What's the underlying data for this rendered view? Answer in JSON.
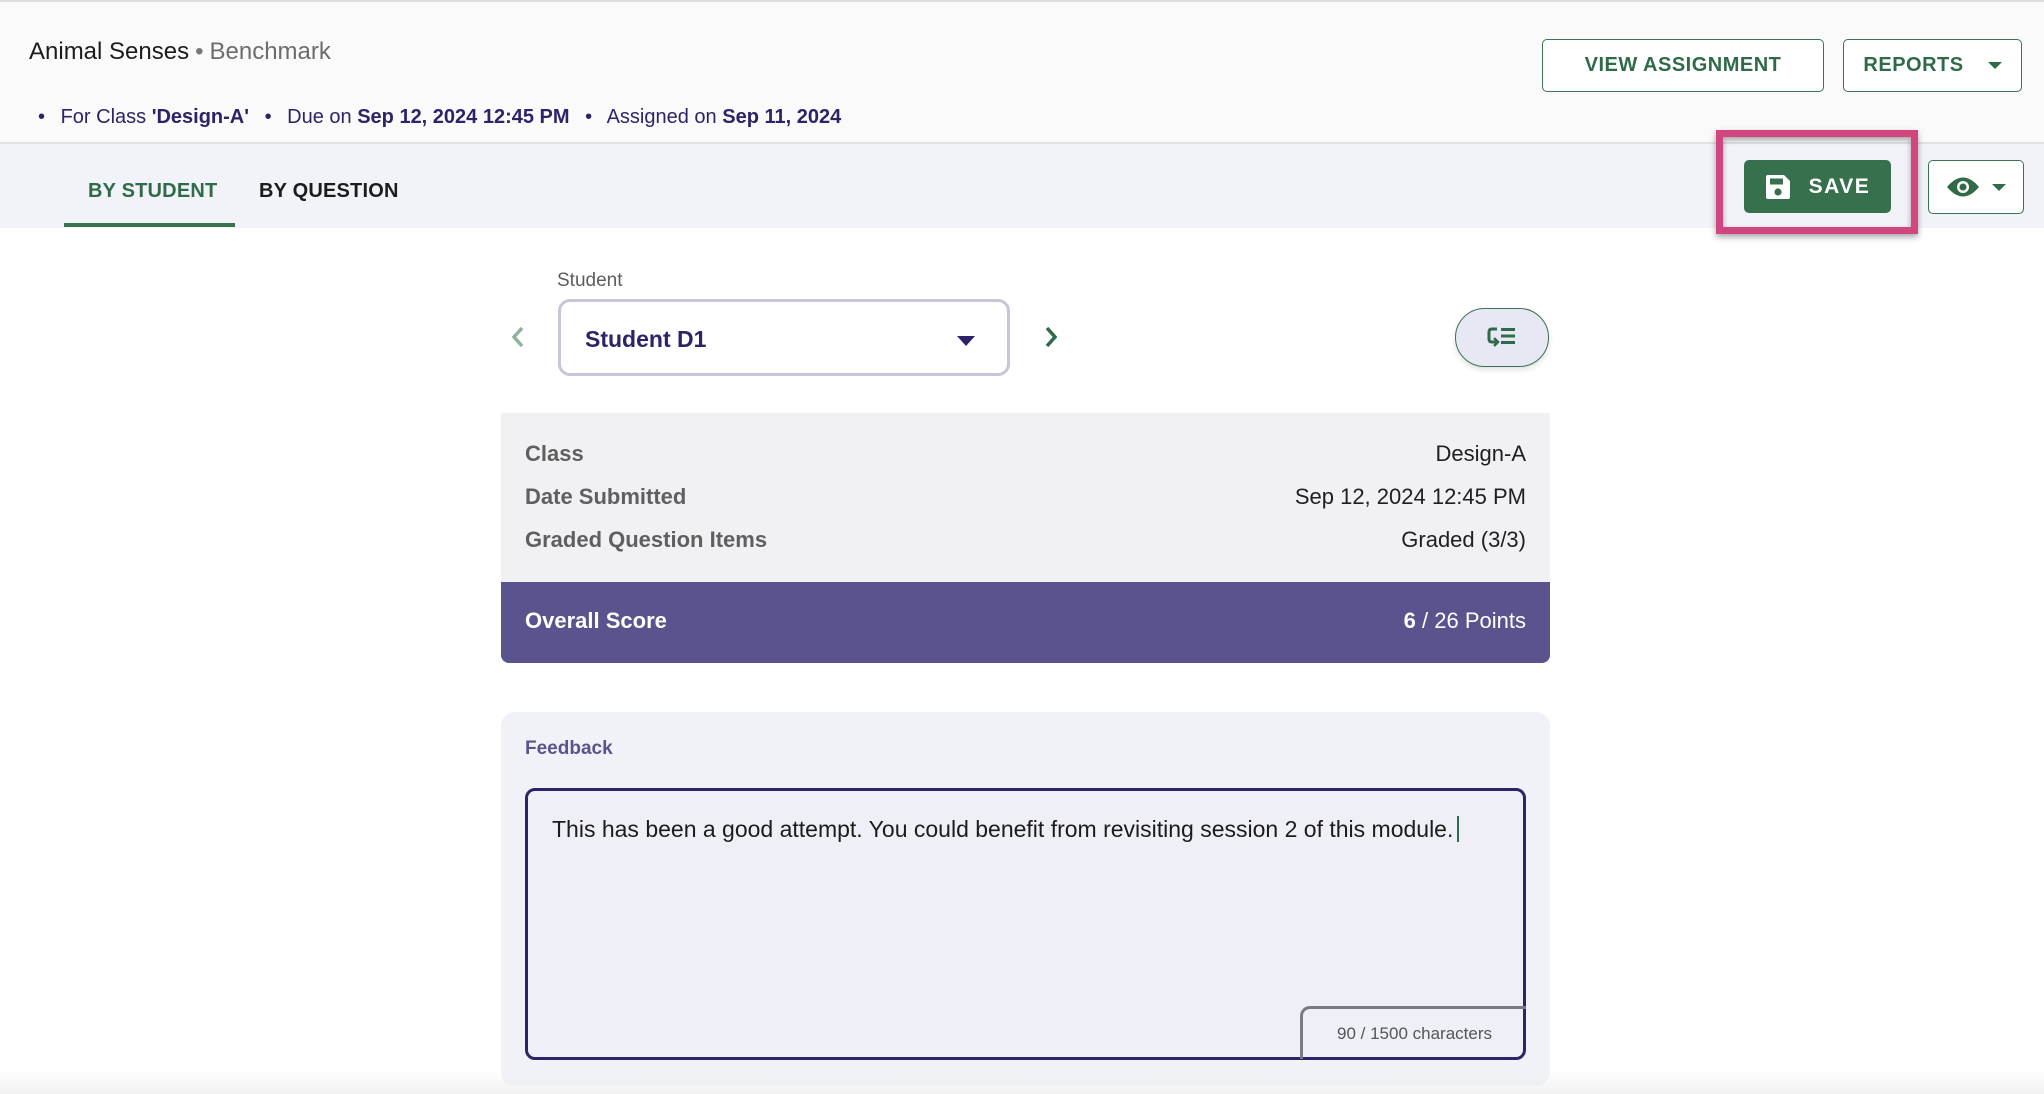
{
  "header": {
    "title": "Animal Senses",
    "separator": "•",
    "subtitle": "Benchmark",
    "meta": {
      "bullet": "•",
      "class_prefix": "For Class ",
      "class_value": "'Design-A'",
      "due_prefix": "Due on ",
      "due_value": "Sep 12, 2024 12:45 PM",
      "assigned_prefix": "Assigned on ",
      "assigned_value": "Sep 11, 2024"
    },
    "view_assignment_label": "VIEW ASSIGNMENT",
    "reports_label": "REPORTS"
  },
  "tabs": [
    {
      "label": "BY STUDENT",
      "active": true
    },
    {
      "label": "BY QUESTION",
      "active": false
    }
  ],
  "toolbar": {
    "save_label": "SAVE",
    "visibility_icon": "eye-icon"
  },
  "student_selector": {
    "label": "Student",
    "selected": "Student D1"
  },
  "info": {
    "rows": [
      {
        "label": "Class",
        "value": "Design-A"
      },
      {
        "label": "Date Submitted",
        "value": "Sep 12, 2024 12:45 PM"
      },
      {
        "label": "Graded Question Items",
        "value": "Graded (3/3)"
      }
    ]
  },
  "score": {
    "label": "Overall Score",
    "earned": "6",
    "total_text": " / 26 Points"
  },
  "feedback": {
    "title": "Feedback",
    "text": "This has been a good attempt. You could benefit from revisiting session 2 of this module.",
    "char_count": "90 / 1500 characters"
  },
  "colors": {
    "brand_green": "#36704c",
    "accent_purple": "#5a548e",
    "text_navy": "#2c2468",
    "highlight_magenta": "#d1467f"
  }
}
